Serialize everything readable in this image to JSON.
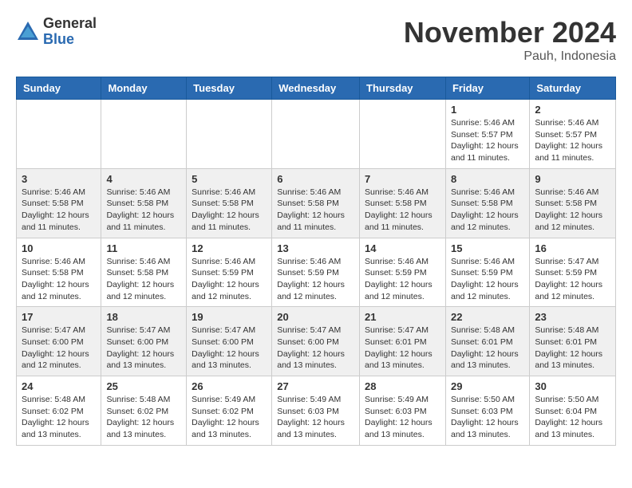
{
  "logo": {
    "general": "General",
    "blue": "Blue"
  },
  "title": "November 2024",
  "location": "Pauh, Indonesia",
  "days_header": [
    "Sunday",
    "Monday",
    "Tuesday",
    "Wednesday",
    "Thursday",
    "Friday",
    "Saturday"
  ],
  "weeks": [
    [
      {
        "day": "",
        "info": ""
      },
      {
        "day": "",
        "info": ""
      },
      {
        "day": "",
        "info": ""
      },
      {
        "day": "",
        "info": ""
      },
      {
        "day": "",
        "info": ""
      },
      {
        "day": "1",
        "info": "Sunrise: 5:46 AM\nSunset: 5:57 PM\nDaylight: 12 hours and 11 minutes."
      },
      {
        "day": "2",
        "info": "Sunrise: 5:46 AM\nSunset: 5:57 PM\nDaylight: 12 hours and 11 minutes."
      }
    ],
    [
      {
        "day": "3",
        "info": "Sunrise: 5:46 AM\nSunset: 5:58 PM\nDaylight: 12 hours and 11 minutes."
      },
      {
        "day": "4",
        "info": "Sunrise: 5:46 AM\nSunset: 5:58 PM\nDaylight: 12 hours and 11 minutes."
      },
      {
        "day": "5",
        "info": "Sunrise: 5:46 AM\nSunset: 5:58 PM\nDaylight: 12 hours and 11 minutes."
      },
      {
        "day": "6",
        "info": "Sunrise: 5:46 AM\nSunset: 5:58 PM\nDaylight: 12 hours and 11 minutes."
      },
      {
        "day": "7",
        "info": "Sunrise: 5:46 AM\nSunset: 5:58 PM\nDaylight: 12 hours and 11 minutes."
      },
      {
        "day": "8",
        "info": "Sunrise: 5:46 AM\nSunset: 5:58 PM\nDaylight: 12 hours and 12 minutes."
      },
      {
        "day": "9",
        "info": "Sunrise: 5:46 AM\nSunset: 5:58 PM\nDaylight: 12 hours and 12 minutes."
      }
    ],
    [
      {
        "day": "10",
        "info": "Sunrise: 5:46 AM\nSunset: 5:58 PM\nDaylight: 12 hours and 12 minutes."
      },
      {
        "day": "11",
        "info": "Sunrise: 5:46 AM\nSunset: 5:58 PM\nDaylight: 12 hours and 12 minutes."
      },
      {
        "day": "12",
        "info": "Sunrise: 5:46 AM\nSunset: 5:59 PM\nDaylight: 12 hours and 12 minutes."
      },
      {
        "day": "13",
        "info": "Sunrise: 5:46 AM\nSunset: 5:59 PM\nDaylight: 12 hours and 12 minutes."
      },
      {
        "day": "14",
        "info": "Sunrise: 5:46 AM\nSunset: 5:59 PM\nDaylight: 12 hours and 12 minutes."
      },
      {
        "day": "15",
        "info": "Sunrise: 5:46 AM\nSunset: 5:59 PM\nDaylight: 12 hours and 12 minutes."
      },
      {
        "day": "16",
        "info": "Sunrise: 5:47 AM\nSunset: 5:59 PM\nDaylight: 12 hours and 12 minutes."
      }
    ],
    [
      {
        "day": "17",
        "info": "Sunrise: 5:47 AM\nSunset: 6:00 PM\nDaylight: 12 hours and 12 minutes."
      },
      {
        "day": "18",
        "info": "Sunrise: 5:47 AM\nSunset: 6:00 PM\nDaylight: 12 hours and 13 minutes."
      },
      {
        "day": "19",
        "info": "Sunrise: 5:47 AM\nSunset: 6:00 PM\nDaylight: 12 hours and 13 minutes."
      },
      {
        "day": "20",
        "info": "Sunrise: 5:47 AM\nSunset: 6:00 PM\nDaylight: 12 hours and 13 minutes."
      },
      {
        "day": "21",
        "info": "Sunrise: 5:47 AM\nSunset: 6:01 PM\nDaylight: 12 hours and 13 minutes."
      },
      {
        "day": "22",
        "info": "Sunrise: 5:48 AM\nSunset: 6:01 PM\nDaylight: 12 hours and 13 minutes."
      },
      {
        "day": "23",
        "info": "Sunrise: 5:48 AM\nSunset: 6:01 PM\nDaylight: 12 hours and 13 minutes."
      }
    ],
    [
      {
        "day": "24",
        "info": "Sunrise: 5:48 AM\nSunset: 6:02 PM\nDaylight: 12 hours and 13 minutes."
      },
      {
        "day": "25",
        "info": "Sunrise: 5:48 AM\nSunset: 6:02 PM\nDaylight: 12 hours and 13 minutes."
      },
      {
        "day": "26",
        "info": "Sunrise: 5:49 AM\nSunset: 6:02 PM\nDaylight: 12 hours and 13 minutes."
      },
      {
        "day": "27",
        "info": "Sunrise: 5:49 AM\nSunset: 6:03 PM\nDaylight: 12 hours and 13 minutes."
      },
      {
        "day": "28",
        "info": "Sunrise: 5:49 AM\nSunset: 6:03 PM\nDaylight: 12 hours and 13 minutes."
      },
      {
        "day": "29",
        "info": "Sunrise: 5:50 AM\nSunset: 6:03 PM\nDaylight: 12 hours and 13 minutes."
      },
      {
        "day": "30",
        "info": "Sunrise: 5:50 AM\nSunset: 6:04 PM\nDaylight: 12 hours and 13 minutes."
      }
    ]
  ]
}
